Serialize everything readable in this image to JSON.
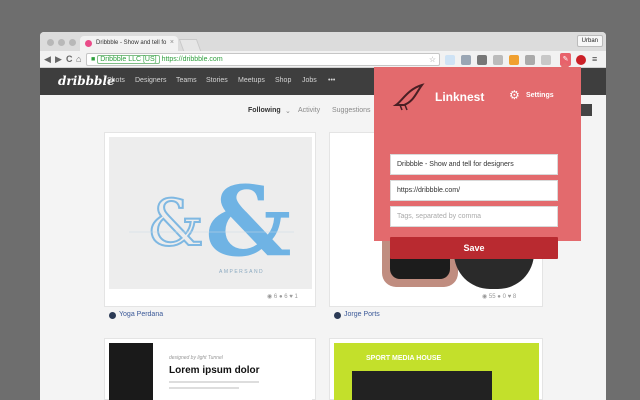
{
  "browser": {
    "tab_title": "Dribbble - Show and tell fo",
    "tab_close": "×",
    "profile": "Urban",
    "back": "◀",
    "forward": "▶",
    "reload": "C",
    "home": "⌂",
    "url_ev": "Dribbble LLC [US]",
    "url": "https://dribbble.com",
    "star": "☆",
    "menu": "≡"
  },
  "site": {
    "logo": "dribbble",
    "nav": [
      "Shots",
      "Designers",
      "Teams",
      "Stories",
      "Meetups",
      "Shop",
      "Jobs",
      "•••"
    ],
    "subnav": {
      "following": "Following",
      "activity": "Activity",
      "suggestions": "Suggestions"
    }
  },
  "shots": [
    {
      "author": "Yoga Perdana",
      "views": "6",
      "comments": "6",
      "likes": "1",
      "art_label": "AMPERSAND"
    },
    {
      "author": "Jorge Ports",
      "views": "55",
      "comments": "0",
      "likes": "8"
    },
    {
      "title": "Lorem ipsum dolor",
      "caption": "designed by light Tunnel"
    },
    {
      "title": "SPORT MEDIA HOUSE"
    }
  ],
  "linknest": {
    "title": "Linknest",
    "settings": "Settings",
    "title_value": "Dribbble - Show and tell for designers",
    "url_value": "https://dribbble.com/",
    "tags_placeholder": "Tags, separated by comma",
    "save": "Save"
  },
  "colors": {
    "linknest_bg": "#e36a6d",
    "save_button": "#b92a30",
    "dribbble_header": "#3e3e3e",
    "dribbble_pink": "#ea4c89"
  }
}
